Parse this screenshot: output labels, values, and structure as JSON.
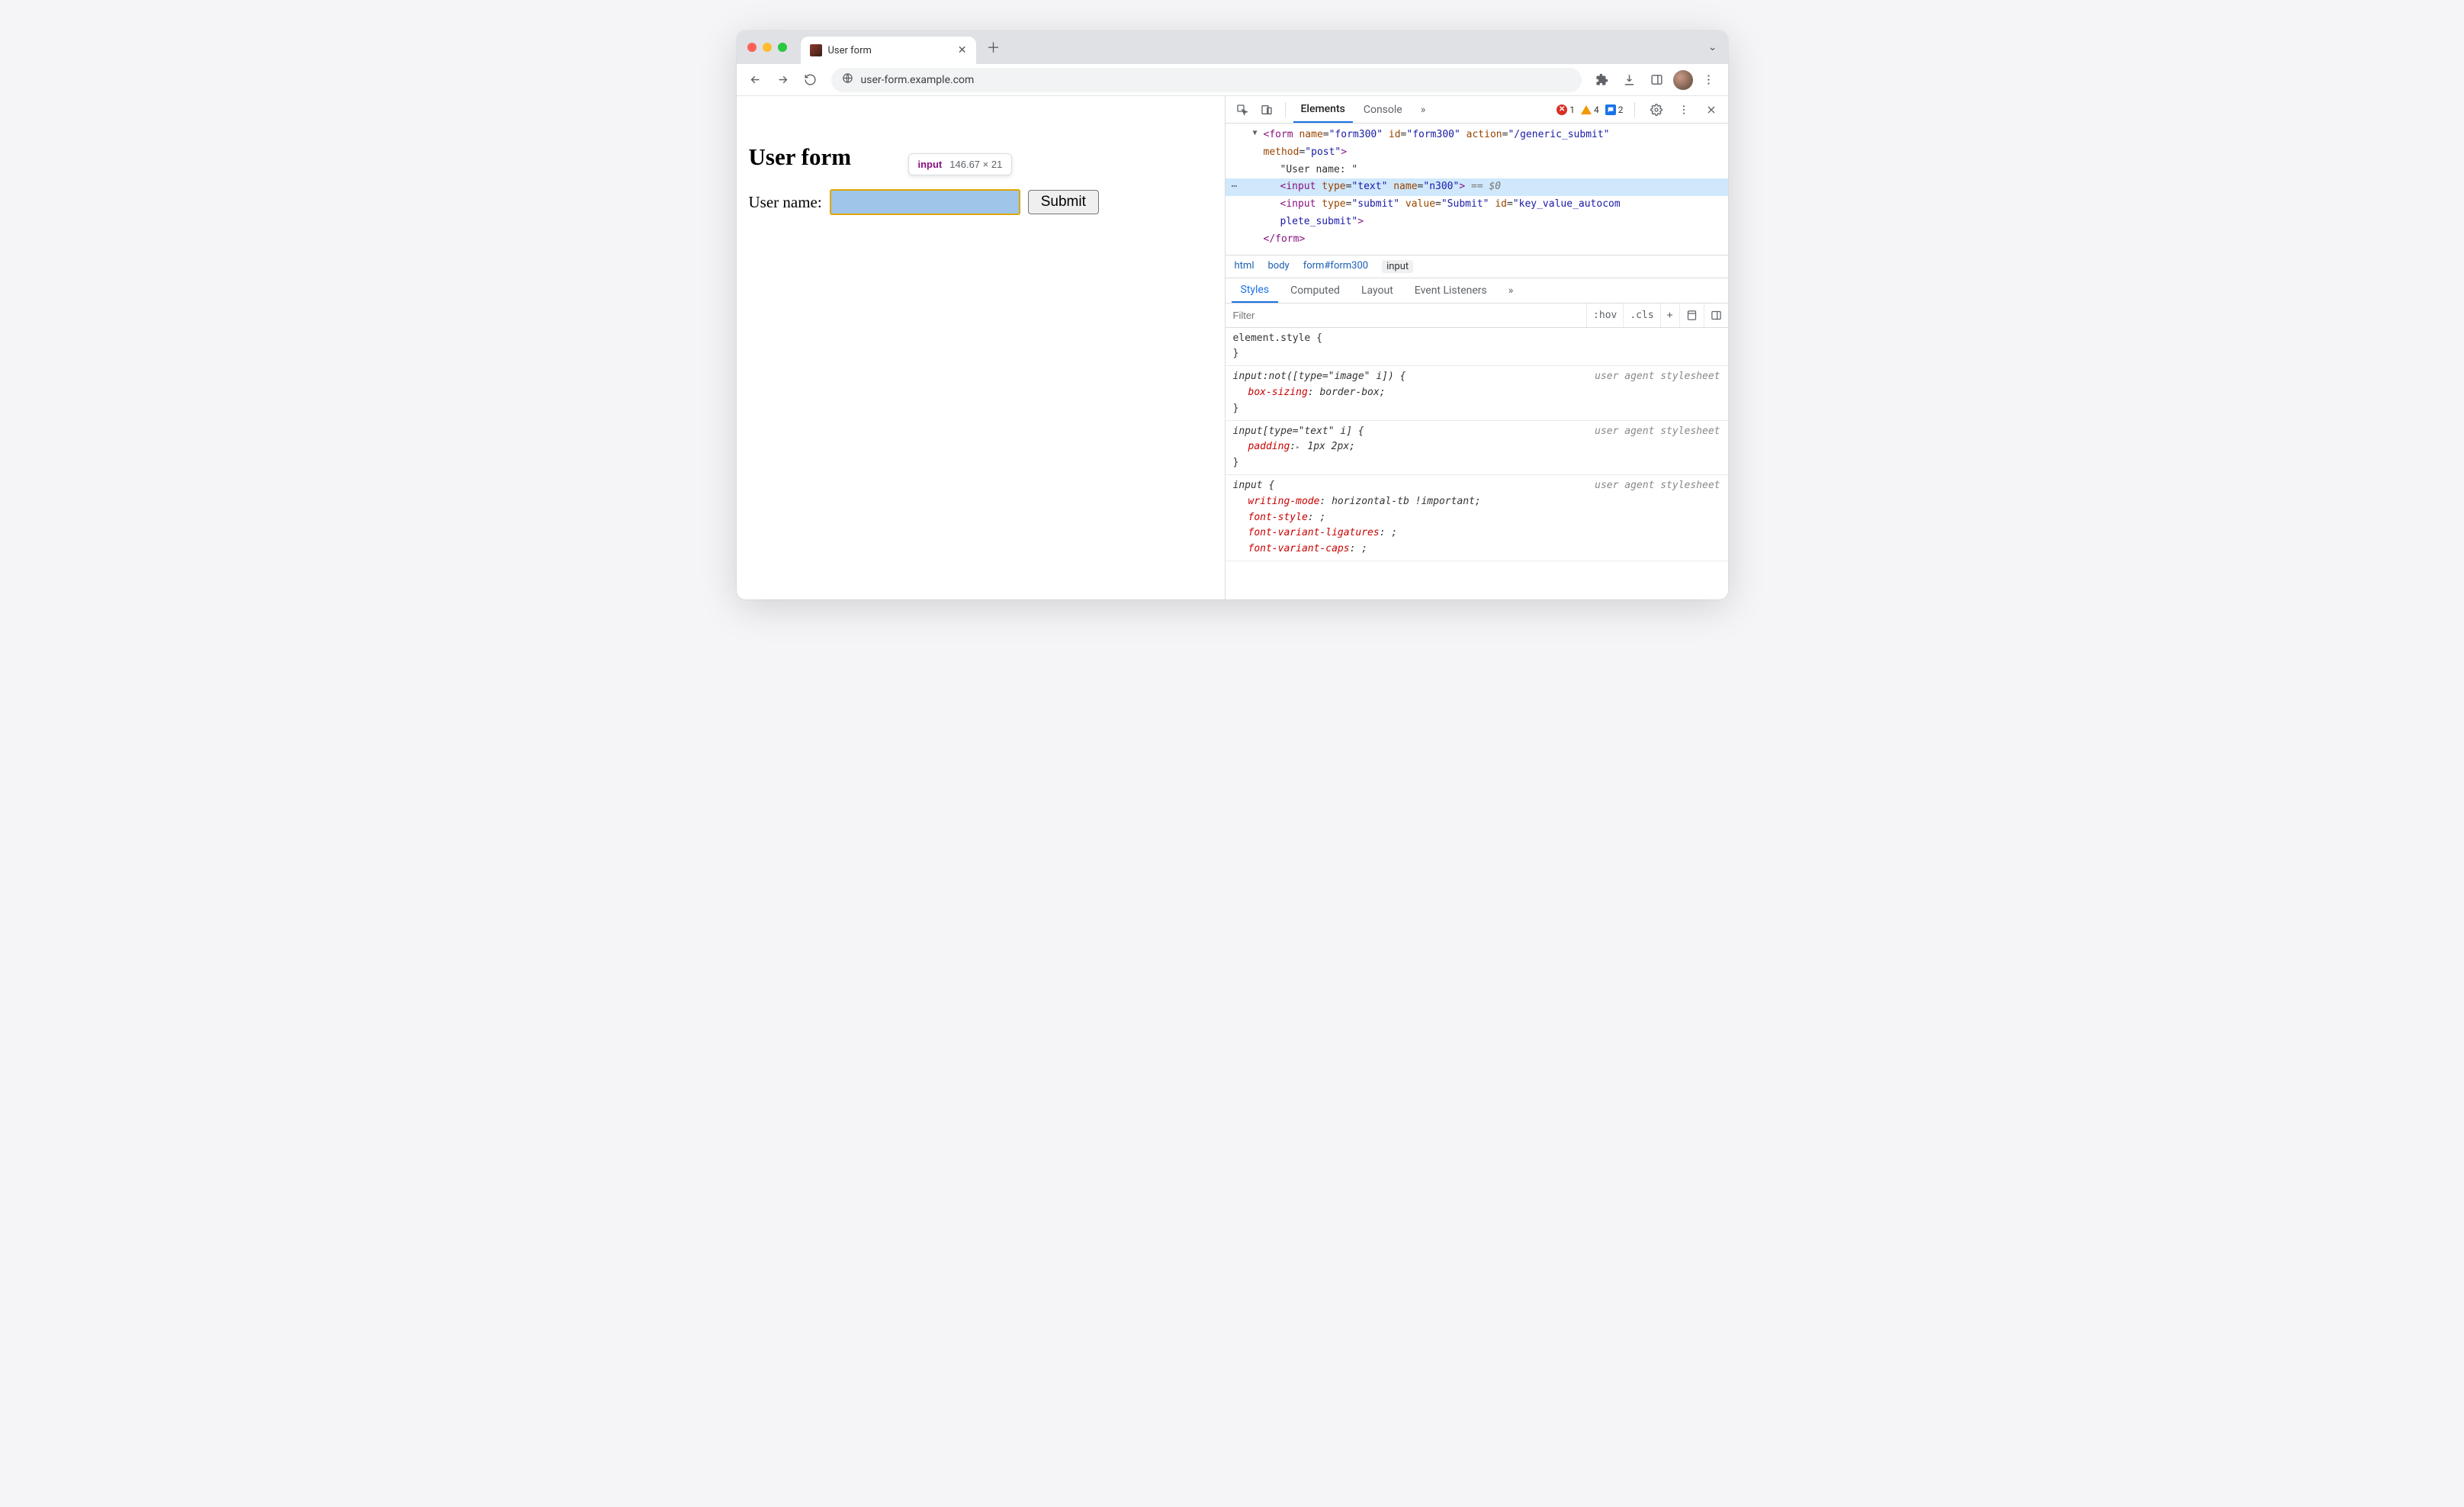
{
  "browser": {
    "tab_title": "User form",
    "url": "user-form.example.com"
  },
  "page": {
    "heading": "User form",
    "label": "User name:",
    "submit": "Submit"
  },
  "tooltip": {
    "tag": "input",
    "dims": "146.67 × 21"
  },
  "devtools": {
    "tabs": {
      "elements": "Elements",
      "console": "Console",
      "more": "»"
    },
    "badges": {
      "errors": "1",
      "warnings": "4",
      "issues": "2"
    },
    "dom": {
      "form_open_1": "<form name=\"form300\" id=\"form300\" action=\"/generic_submit\"",
      "form_open_2": "method=\"post\">",
      "text_node": "\"User name: \"",
      "input_text": "<input type=\"text\" name=\"n300\">",
      "eq_dollar": " == $0",
      "input_submit_1": "<input type=\"submit\" value=\"Submit\" id=\"key_value_autocom",
      "input_submit_2": "plete_submit\">",
      "form_close": "</form>"
    },
    "crumb": {
      "c1": "html",
      "c2": "body",
      "c3": "form#form300",
      "c4": "input"
    },
    "styles_tabs": {
      "styles": "Styles",
      "computed": "Computed",
      "layout": "Layout",
      "listeners": "Event Listeners",
      "more": "»"
    },
    "styles_toolbar": {
      "filter": "Filter",
      "hov": ":hov",
      "cls": ".cls",
      "plus": "+"
    },
    "rules": {
      "r0_sel": "element.style {",
      "r0_end": "}",
      "ua": "user agent stylesheet",
      "r1_sel": "input:not([type=\"image\" i]) {",
      "r1_p": "box-sizing",
      "r1_v": "border-box",
      "r1_end": "}",
      "r2_sel": "input[type=\"text\" i] {",
      "r2_p": "padding",
      "r2_v": "1px 2px",
      "r2_end": "}",
      "r3_sel": "input {",
      "r3_p1": "writing-mode",
      "r3_v1": "horizontal-tb !important",
      "r3_p2": "font-style",
      "r3_v2": "",
      "r3_p3": "font-variant-ligatures",
      "r3_v3": "",
      "r3_p4": "font-variant-caps",
      "r3_v4": ""
    }
  }
}
